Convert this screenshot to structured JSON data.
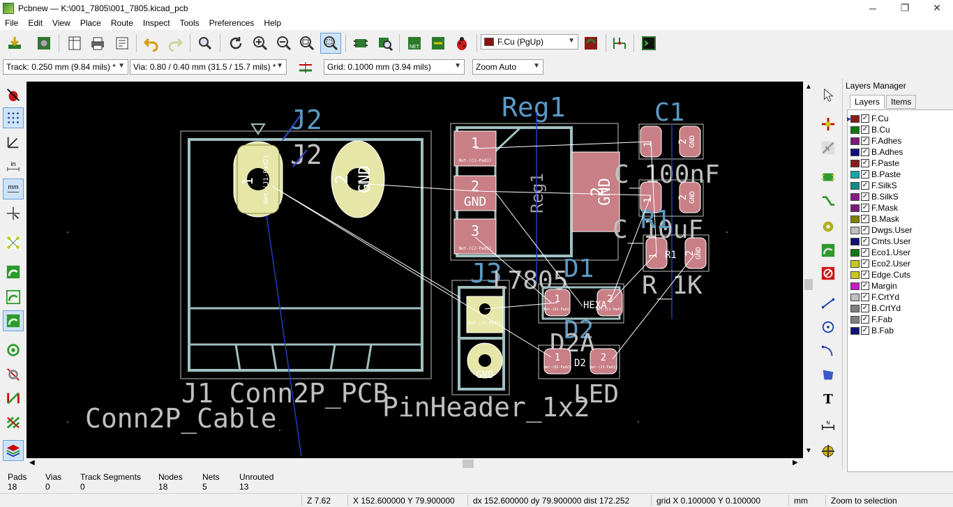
{
  "window": {
    "title": "Pcbnew — K:\\001_7805\\001_7805.kicad_pcb",
    "minimize": "─",
    "maximize": "❐",
    "close": "✕"
  },
  "menu": [
    "File",
    "Edit",
    "View",
    "Place",
    "Route",
    "Inspect",
    "Tools",
    "Preferences",
    "Help"
  ],
  "toolbar": {
    "layer_select": "F.Cu (PgUp)",
    "track": "Track: 0.250 mm (9.84 mils) *",
    "via": "Via: 0.80 / 0.40 mm (31.5 / 15.7 mils) *",
    "grid": "Grid: 0.1000 mm (3.94 mils)",
    "zoom": "Zoom Auto"
  },
  "pcb": {
    "j2_ref": "J2",
    "j2_value": "J2",
    "j1_label": "J1 Conn2P_PCB",
    "conn_cable": "Conn2P_Cable",
    "pinheader": "PinHeader_1x2",
    "j3_ref": "J3",
    "reg1_ref": "Reg1",
    "reg1_body": "Reg1",
    "l7805": "L7805",
    "c1_ref": "C1",
    "c1_value": "C_100nF",
    "c2_value": "C_10uF",
    "r1_ref": "R1",
    "r1_value": "R_1K",
    "d1_ref": "D1",
    "d2_ref": "D2",
    "d2_value": "D2A",
    "led": "LED",
    "pad1": "1",
    "pad2": "2",
    "pad3": "3",
    "gnd": "GND",
    "net_c1": "Net-(C1-Pad1)",
    "net_c2": "Net-(C2-Pad1)",
    "net_j1": "Net-(J1-Pad2)",
    "net_d1": "Net-(D1-Pad1)",
    "net_d2": "Net-(D2-Pad2)",
    "net_j3": "Net-(J3-Pad1)",
    "hexa": "HEXA"
  },
  "layers_manager": {
    "title": "Layers Manager",
    "tabs": [
      "Layers",
      "Items"
    ],
    "layers": [
      {
        "name": "F.Cu",
        "color": "#8b1a1a"
      },
      {
        "name": "B.Cu",
        "color": "#0e7a0e"
      },
      {
        "name": "F.Adhes",
        "color": "#7a1a7a"
      },
      {
        "name": "B.Adhes",
        "color": "#10107a"
      },
      {
        "name": "F.Paste",
        "color": "#8b1a1a"
      },
      {
        "name": "B.Paste",
        "color": "#12a7a7"
      },
      {
        "name": "F.SilkS",
        "color": "#138a8a"
      },
      {
        "name": "B.SilkS",
        "color": "#8a1a8a"
      },
      {
        "name": "F.Mask",
        "color": "#7a1a7a"
      },
      {
        "name": "B.Mask",
        "color": "#808000"
      },
      {
        "name": "Dwgs.User",
        "color": "#c0c0c0"
      },
      {
        "name": "Cmts.User",
        "color": "#10107a"
      },
      {
        "name": "Eco1.User",
        "color": "#0e7a0e"
      },
      {
        "name": "Eco2.User",
        "color": "#c8c81a"
      },
      {
        "name": "Edge.Cuts",
        "color": "#c8c81a"
      },
      {
        "name": "Margin",
        "color": "#c81ac8"
      },
      {
        "name": "F.CrtYd",
        "color": "#c0c0c0"
      },
      {
        "name": "B.CrtYd",
        "color": "#808080"
      },
      {
        "name": "F.Fab",
        "color": "#808080"
      },
      {
        "name": "B.Fab",
        "color": "#10107a"
      }
    ]
  },
  "message_panel": [
    {
      "label": "Pads",
      "value": "18"
    },
    {
      "label": "Vias",
      "value": "0"
    },
    {
      "label": "Track Segments",
      "value": "0"
    },
    {
      "label": "Nodes",
      "value": "18"
    },
    {
      "label": "Nets",
      "value": "5"
    },
    {
      "label": "Unrouted",
      "value": "13"
    }
  ],
  "status": {
    "zoom": "Z 7.62",
    "xy": "X 152.600000  Y 79.900000",
    "dxy": "dx 152.600000  dy 79.900000  dist 172.252",
    "grid": "grid X 0.100000  Y 0.100000",
    "units": "mm",
    "mode": "Zoom to selection"
  }
}
